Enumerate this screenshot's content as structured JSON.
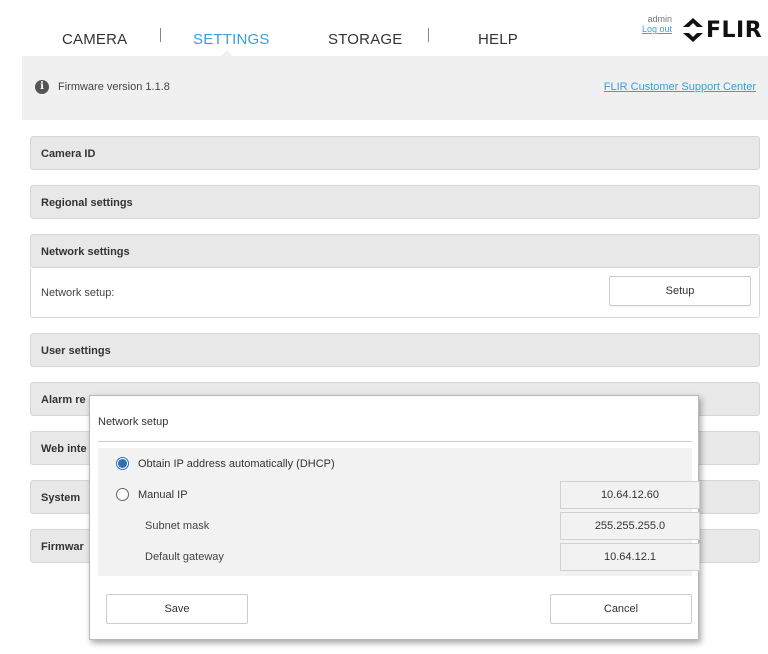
{
  "nav": {
    "items": [
      {
        "label": "CAMERA"
      },
      {
        "label": "SETTINGS"
      },
      {
        "label": "STORAGE"
      },
      {
        "label": "HELP"
      }
    ],
    "active": "SETTINGS",
    "accent_color": "#3aa0d5"
  },
  "user": {
    "name": "admin",
    "logout": "Log out"
  },
  "brand": {
    "logo_text": "FLIR",
    "logo_icon": "flir-diamond-logo-icon"
  },
  "firmware": {
    "version_text": "Firmware version 1.1.8",
    "info_icon": "info-icon",
    "support_link": "FLIR Customer Support Center"
  },
  "sections": {
    "camera_id": "Camera ID",
    "regional": "Regional settings",
    "network": "Network settings",
    "network_setup_label": "Network setup:",
    "network_setup_button": "Setup",
    "user": "User settings",
    "alarm": "Alarm re",
    "web": "Web inte",
    "system": "System",
    "firmware": "Firmwar"
  },
  "modal": {
    "title": "Network setup",
    "dhcp_label": "Obtain IP address automatically (DHCP)",
    "dhcp_selected": true,
    "manual_label": "Manual IP",
    "manual_selected": false,
    "manual_ip": "10.64.12.60",
    "subnet_label": "Subnet mask",
    "subnet_value": "255.255.255.0",
    "gateway_label": "Default gateway",
    "gateway_value": "10.64.12.1",
    "save_label": "Save",
    "cancel_label": "Cancel",
    "radio_color": "#2f6fb9"
  }
}
